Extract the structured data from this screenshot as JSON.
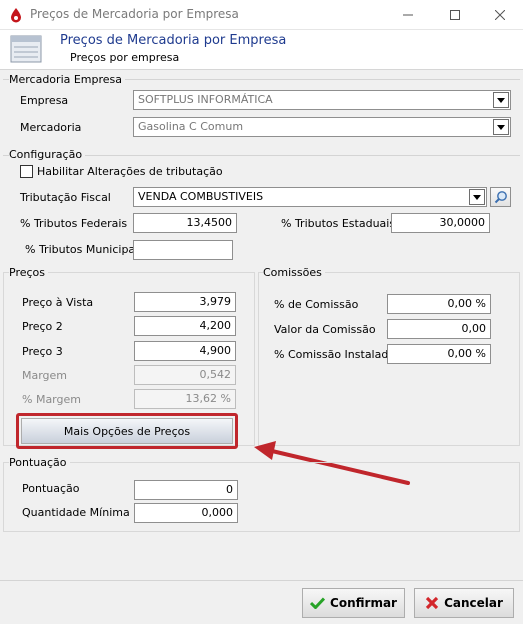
{
  "window": {
    "title": "Preços de Mercadoria por Empresa"
  },
  "header": {
    "title": "Preços de Mercadoria por Empresa",
    "subtitle": "Preços por empresa"
  },
  "mercadoria_empresa": {
    "group_title": "Mercadoria Empresa",
    "empresa_label": "Empresa",
    "empresa_value": "SOFTPLUS INFORMÁTICA",
    "mercadoria_label": "Mercadoria",
    "mercadoria_value": "Gasolina C Comum"
  },
  "configuracao": {
    "group_title": "Configuração",
    "habilitar_label": "Habilitar Alterações de tributação",
    "habilitar_checked": false,
    "tributacao_label": "Tributação Fiscal",
    "tributacao_value": "VENDA COMBUSTIVEIS",
    "federais_label": "% Tributos Federais",
    "federais_value": "13,4500",
    "estaduais_label": "% Tributos Estaduais",
    "estaduais_value": "30,0000",
    "municipais_label": "% Tributos Municipais",
    "municipais_value": ""
  },
  "precos": {
    "group_title": "Preços",
    "preco_vista_label": "Preço à Vista",
    "preco_vista_value": "3,979",
    "preco2_label": "Preço 2",
    "preco2_value": "4,200",
    "preco3_label": "Preço 3",
    "preco3_value": "4,900",
    "margem_label": "Margem",
    "margem_value": "0,542",
    "pct_margem_label": "% Margem",
    "pct_margem_value": "13,62 %",
    "mais_opcoes_label": "Mais Opções de Preços"
  },
  "comissoes": {
    "group_title": "Comissões",
    "pct_comissao_label": "% de Comissão",
    "pct_comissao_value": "0,00 %",
    "valor_comissao_label": "Valor da Comissão",
    "valor_comissao_value": "0,00",
    "pct_instalador_label": "% Comissão Instalador",
    "pct_instalador_value": "0,00 %"
  },
  "pontuacao": {
    "group_title": "Pontuação",
    "pontuacao_label": "Pontuação",
    "pontuacao_value": "0",
    "qtd_minima_label": "Quantidade Mínima",
    "qtd_minima_value": "0,000"
  },
  "footer": {
    "confirmar_label": "Confirmar",
    "cancelar_label": "Cancelar"
  },
  "colors": {
    "highlight_box": "#c0262c",
    "arrow": "#c0262c",
    "header_title": "#1f3b8f"
  }
}
